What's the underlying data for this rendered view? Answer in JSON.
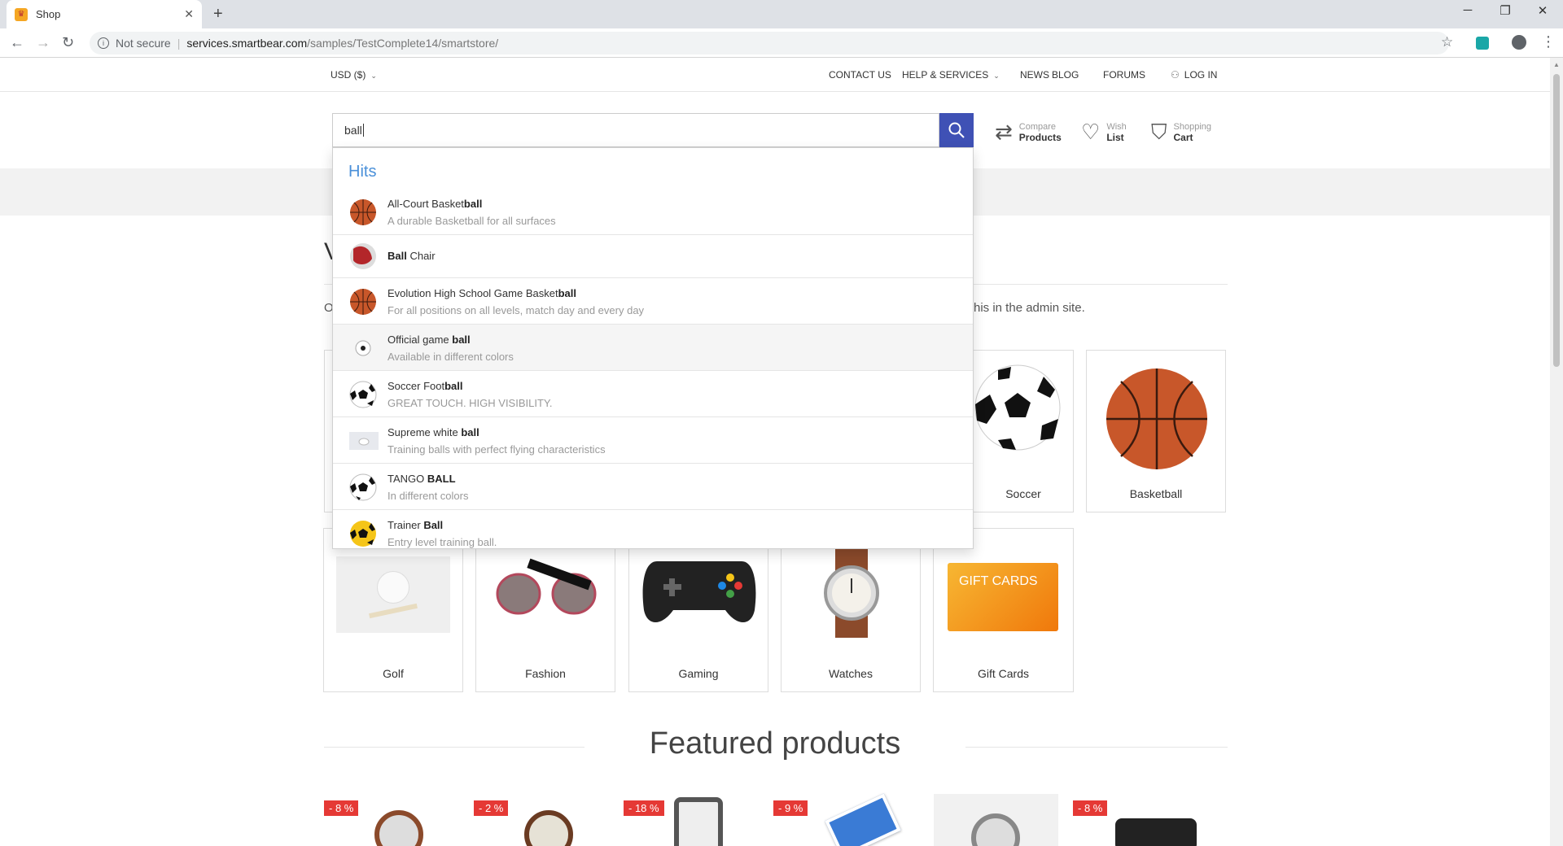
{
  "browser": {
    "tab_title": "Shop",
    "new_tab": "+",
    "not_secure": "Not secure",
    "url_host": "services.smartbear.com",
    "url_path": "/samples/TestComplete14/smartstore/"
  },
  "topbar": {
    "currency": "USD  ($)",
    "contact": "CONTACT US",
    "help": "HELP & SERVICES",
    "news": "NEWS",
    "blog": "BLOG",
    "forums": "FORUMS",
    "login": "LOG IN"
  },
  "search": {
    "value": "ball"
  },
  "header_icons": {
    "compare_small": "Compare",
    "compare_big": "Products",
    "wish_small": "Wish",
    "wish_big": "List",
    "cart_small": "Shopping",
    "cart_big": "Cart"
  },
  "page": {
    "welcome_fragment": "V",
    "info_left_fragment": "O",
    "info_right_fragment": "his in the admin site.",
    "featured_title": "Featured products"
  },
  "categories": [
    {
      "label": "Soccer"
    },
    {
      "label": "Basketball"
    },
    {
      "label": "Golf"
    },
    {
      "label": "Fashion"
    },
    {
      "label": "Gaming"
    },
    {
      "label": "Watches"
    },
    {
      "label": "Gift Cards"
    }
  ],
  "gift_card_text": "GIFT CARDS",
  "badges": [
    "- 8 %",
    "- 2 %",
    "- 18 %",
    "- 9 %",
    "- 8 %"
  ],
  "dropdown": {
    "heading": "Hits",
    "items": [
      {
        "pre": "All-Court Basket",
        "bold": "ball",
        "post": "",
        "desc": "A durable Basketball for all surfaces"
      },
      {
        "pre": "",
        "bold": "Ball",
        "post": " Chair",
        "desc": ""
      },
      {
        "pre": "Evolution High School Game Basket",
        "bold": "ball",
        "post": "",
        "desc": "For all positions on all levels, match day and every day"
      },
      {
        "pre": "Official game ",
        "bold": "ball",
        "post": "",
        "desc": "Available in different colors"
      },
      {
        "pre": "Soccer Foot",
        "bold": "ball",
        "post": "",
        "desc": "GREAT TOUCH. HIGH VISIBILITY."
      },
      {
        "pre": "Supreme white ",
        "bold": "ball",
        "post": "",
        "desc": "Training balls with perfect flying characteristics"
      },
      {
        "pre": "TANGO ",
        "bold": "BALL",
        "post": "",
        "desc": "In different colors"
      },
      {
        "pre": "Trainer ",
        "bold": "Ball",
        "post": "",
        "desc": "Entry level training ball."
      }
    ]
  },
  "colors": {
    "search_button": "#3f51b5",
    "hits_heading": "#4a90d9",
    "badge": "#e53935"
  }
}
